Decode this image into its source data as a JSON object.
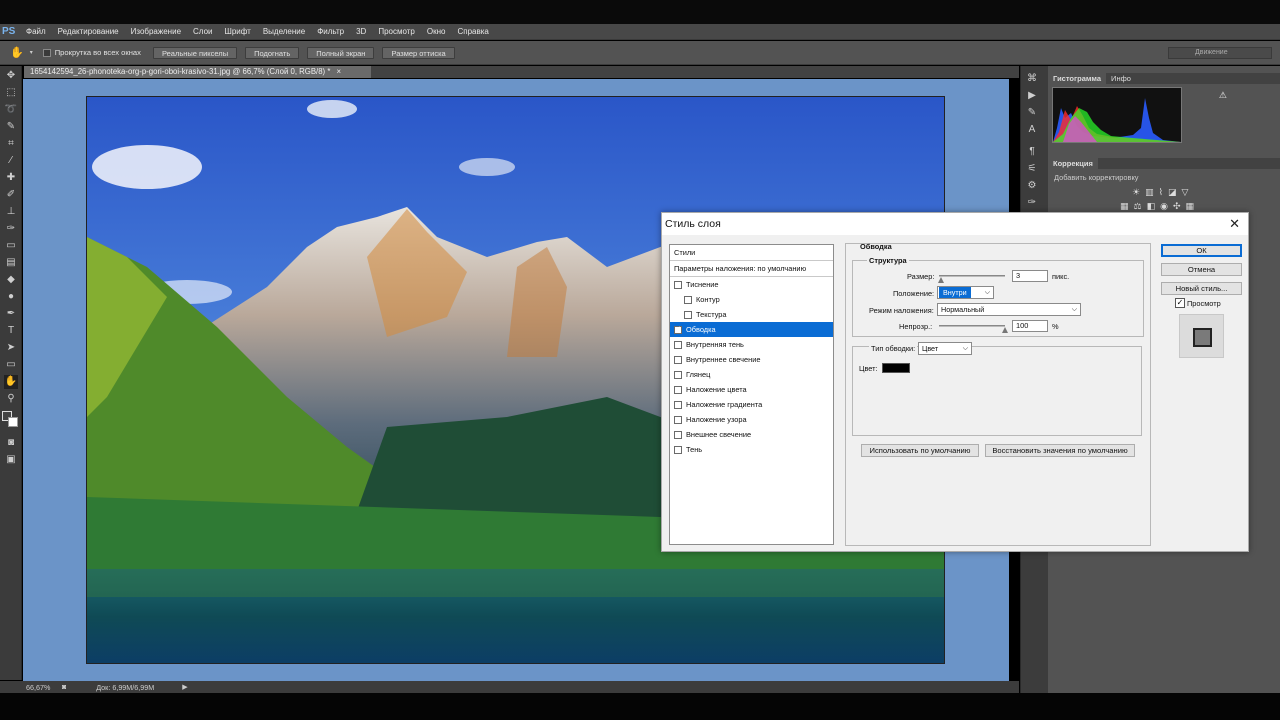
{
  "app": {
    "logo": "PS"
  },
  "menu": [
    "Файл",
    "Редактирование",
    "Изображение",
    "Слои",
    "Шрифт",
    "Выделение",
    "Фильтр",
    "3D",
    "Просмотр",
    "Окно",
    "Справка"
  ],
  "options": {
    "scroll_all": "Прокрутка во всех окнах",
    "buttons": [
      "Реальные пикселы",
      "Подогнать",
      "Полный экран",
      "Размер оттиска"
    ],
    "workspace": "Движение"
  },
  "document": {
    "tab_title": "1654142594_26-phonoteka-org-p-gori-oboi-krasivo-31.jpg @ 66,7% (Слой 0, RGB/8) *",
    "close": "×"
  },
  "status": {
    "zoom": "66,67%",
    "doc": "Док: 6,99M/6,99M"
  },
  "panels": {
    "histogram_tab": "Гистограмма",
    "info_tab": "Инфо",
    "correction_tab": "Коррекция",
    "add_correction": "Добавить корректировку"
  },
  "dialog": {
    "title": "Стиль слоя",
    "styles_header": "Стили",
    "blend_options": "Параметры наложения: по умолчанию",
    "styles": [
      {
        "label": "Тиснение",
        "checked": false,
        "sub": false,
        "selected": false
      },
      {
        "label": "Контур",
        "checked": false,
        "sub": true,
        "selected": false
      },
      {
        "label": "Текстура",
        "checked": false,
        "sub": true,
        "selected": false
      },
      {
        "label": "Обводка",
        "checked": true,
        "sub": false,
        "selected": true
      },
      {
        "label": "Внутренняя тень",
        "checked": false,
        "sub": false,
        "selected": false
      },
      {
        "label": "Внутреннее свечение",
        "checked": false,
        "sub": false,
        "selected": false
      },
      {
        "label": "Глянец",
        "checked": false,
        "sub": false,
        "selected": false
      },
      {
        "label": "Наложение цвета",
        "checked": false,
        "sub": false,
        "selected": false
      },
      {
        "label": "Наложение градиента",
        "checked": false,
        "sub": false,
        "selected": false
      },
      {
        "label": "Наложение узора",
        "checked": false,
        "sub": false,
        "selected": false
      },
      {
        "label": "Внешнее свечение",
        "checked": false,
        "sub": false,
        "selected": false
      },
      {
        "label": "Тень",
        "checked": false,
        "sub": false,
        "selected": false
      }
    ],
    "stroke": {
      "section": "Обводка",
      "structure": "Структура",
      "size_label": "Размер:",
      "size_value": "3",
      "size_unit": "пикс.",
      "position_label": "Положение:",
      "position_value": "Внутри",
      "blend_label": "Режим наложения:",
      "blend_value": "Нормальный",
      "opacity_label": "Непрозр.:",
      "opacity_value": "100",
      "opacity_unit": "%",
      "fill_type_label": "Тип обводки:",
      "fill_type_value": "Цвет",
      "color_label": "Цвет:",
      "color": "#000000",
      "use_default": "Использовать по умолчанию",
      "reset_default": "Восстановить значения по умолчанию"
    },
    "buttons": {
      "ok": "ОК",
      "cancel": "Отмена",
      "new_style": "Новый стиль...",
      "preview": "Просмотр"
    }
  },
  "colors": {
    "accent": "#0a6cd4",
    "canvas_bg": "#6b94c8"
  }
}
